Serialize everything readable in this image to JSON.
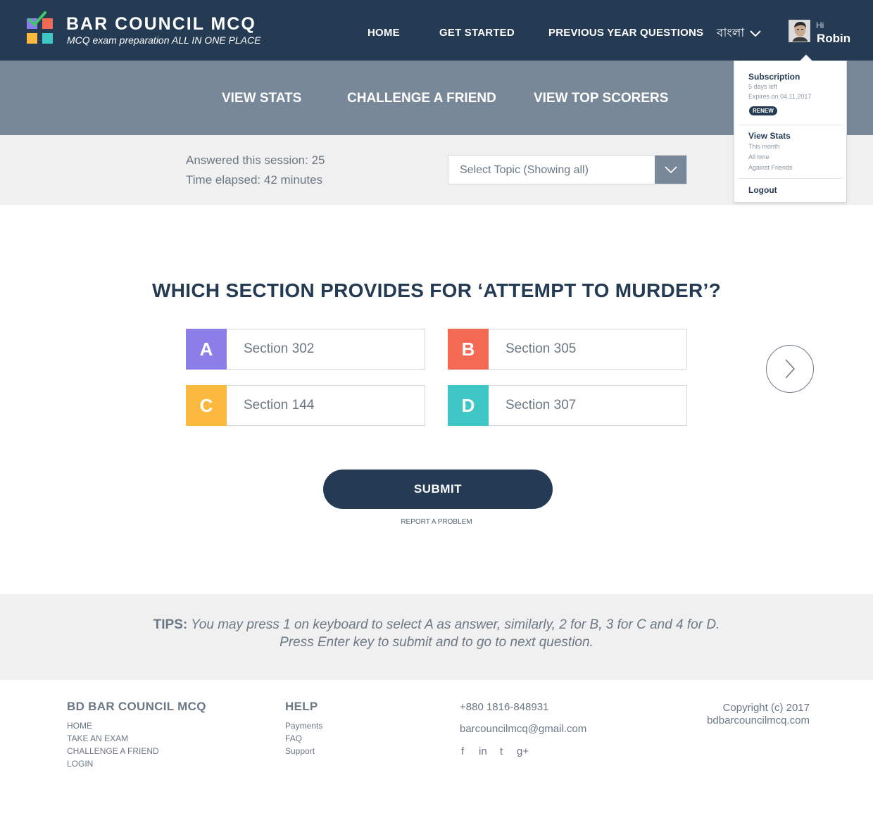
{
  "brand": {
    "title": "BAR COUNCIL MCQ",
    "subtitle": "MCQ exam preparation ALL IN ONE PLACE"
  },
  "nav": {
    "items": [
      {
        "label": "HOME"
      },
      {
        "label": "GET STARTED"
      },
      {
        "label": "PREVIOUS YEAR QUESTIONS"
      }
    ],
    "language": "বাংলা",
    "greeting": "Hi",
    "username": "Robin"
  },
  "subnav": {
    "items": [
      {
        "label": "VIEW STATS"
      },
      {
        "label": "CHALLENGE A FRIEND"
      },
      {
        "label": "VIEW TOP SCORERS"
      }
    ]
  },
  "session": {
    "answered": "Answered this session: 25",
    "elapsed": "Time elapsed: 42 minutes",
    "topic_select": "Select Topic (Showing all)"
  },
  "user_menu": {
    "subscription_title": "Subscription",
    "days_left": "5 days left",
    "expires": "Expires on 04.11.2017",
    "renew": "RENEW",
    "stats_title": "View Stats",
    "stats_links": [
      "This month",
      "All time",
      "Against Friends"
    ],
    "logout": "Logout"
  },
  "question": {
    "text": "WHICH SECTION  PROVIDES FOR ‘ATTEMPT TO MURDER’?",
    "options": [
      {
        "letter": "A",
        "text": "Section 302",
        "color": "#8b7ee8"
      },
      {
        "letter": "B",
        "text": "Section 305",
        "color": "#f26a54"
      },
      {
        "letter": "C",
        "text": "Section 144",
        "color": "#fbb93f"
      },
      {
        "letter": "D",
        "text": "Section 307",
        "color": "#3ec7c4"
      }
    ],
    "submit": "SUBMIT",
    "report": "REPORT A PROBLEM"
  },
  "tips": {
    "label": "TIPS:",
    "line1": " You may press 1 on keyboard to select A as answer, similarly, 2 for B, 3 for C and 4 for D.",
    "line2": "Press Enter key to submit and to go to next question."
  },
  "footer": {
    "col1_title": "BD BAR COUNCIL MCQ",
    "col1_links": [
      "HOME",
      "TAKE AN EXAM",
      "CHALLENGE A FRIEND",
      "LOGIN"
    ],
    "col2_title": "HELP",
    "col2_links": [
      "Payments",
      "FAQ",
      "Support"
    ],
    "phone": "+880 1816-848931",
    "email": "barcouncilmcq@gmail.com",
    "social": [
      "f",
      "in",
      "t",
      "g+"
    ],
    "copyright": "Copyright (c) 2017",
    "website": "bdbarcouncilmcq.com"
  },
  "colors": {
    "header_bg": "#253b53",
    "subnav_bg": "#788899",
    "text_muted": "#6b7885"
  }
}
